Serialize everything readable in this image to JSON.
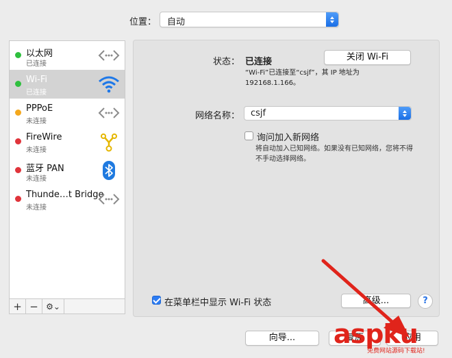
{
  "location": {
    "label": "位置：",
    "value": "自动"
  },
  "services": [
    {
      "name": "以太网",
      "status": "已连接",
      "dot_color": "#2fbf3e",
      "icon": "ethernet-icon",
      "selected": false
    },
    {
      "name": "Wi-Fi",
      "status": "已连接",
      "dot_color": "#2fbf3e",
      "icon": "wifi-icon",
      "selected": true
    },
    {
      "name": "PPPoE",
      "status": "未连接",
      "dot_color": "#f4a81d",
      "icon": "pppoe-icon",
      "selected": false
    },
    {
      "name": "FireWire",
      "status": "未连接",
      "dot_color": "#e0343b",
      "icon": "firewire-icon",
      "selected": false
    },
    {
      "name": "蓝牙 PAN",
      "status": "未连接",
      "dot_color": "#e0343b",
      "icon": "bluetooth-icon",
      "selected": false
    },
    {
      "name": "Thunde…t Bridge",
      "status": "未连接",
      "dot_color": "#e0343b",
      "icon": "thunderbolt-bridge-icon",
      "selected": false
    }
  ],
  "sidebar_bar": {
    "add": "+",
    "remove": "−",
    "action": "⚙⌄"
  },
  "detail": {
    "status_label": "状态：",
    "status_value": "已连接",
    "wifi_off_button": "关闭 Wi-Fi",
    "status_description": "“Wi-Fi”已连接至“csjf”，其 IP 地址为 192168.1.166。",
    "network_name_label": "网络名称：",
    "network_name_value": "csjf",
    "ask_join_label": "询问加入新网络",
    "ask_join_checked": false,
    "ask_join_description": "将自动加入已知网络。如果没有已知网络，您将不得不手动选择网络。",
    "show_in_menubar_label": "在菜单栏中显示 Wi-Fi 状态",
    "show_in_menubar_checked": true,
    "advanced_button": "高级...",
    "help_button": "?"
  },
  "footer": {
    "assist_button": "向导...",
    "revert_button": "复原",
    "apply_button": "应用"
  },
  "watermark": {
    "brand": "aspku",
    "subtitle": "免费网站源码下载站!"
  },
  "colors": {
    "accent": "#2d7cf3",
    "selection": "#d3d3d3",
    "arrow": "#e0241b"
  }
}
